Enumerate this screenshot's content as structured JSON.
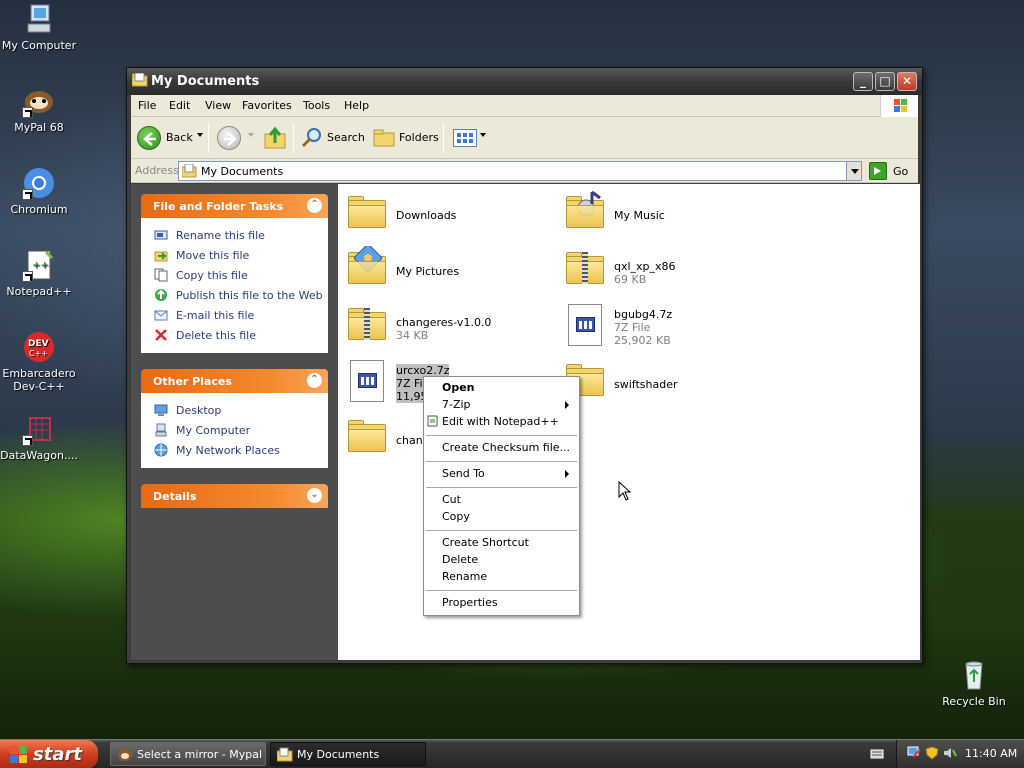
{
  "desktop": {
    "icons": [
      {
        "label": "My Computer",
        "icon": "my-computer-icon"
      },
      {
        "label": "MyPal 68",
        "icon": "mypal-icon"
      },
      {
        "label": "Chromium",
        "icon": "chromium-icon"
      },
      {
        "label": "Notepad++",
        "icon": "notepad-plus-plus-icon"
      },
      {
        "label": "Embarcadero Dev-C++",
        "icon": "dev-cpp-icon",
        "badge": "DEV C++"
      },
      {
        "label": "DataWagon....",
        "icon": "datawagon-icon"
      },
      {
        "label": "Recycle Bin",
        "icon": "recycle-bin-icon"
      }
    ]
  },
  "window": {
    "title": "My Documents",
    "controls": {
      "minimize": "_",
      "maximize": "□",
      "close": "✕"
    },
    "menu": [
      "File",
      "Edit",
      "View",
      "Favorites",
      "Tools",
      "Help"
    ],
    "toolbar": {
      "back": "Back",
      "search": "Search",
      "folders": "Folders"
    },
    "address": {
      "label": "Address",
      "value": "My Documents",
      "go": "Go"
    }
  },
  "taskpane": {
    "file_tasks": {
      "title": "File and Folder Tasks",
      "items": [
        {
          "label": "Rename this file",
          "icon": "rename-icon"
        },
        {
          "label": "Move this file",
          "icon": "move-icon"
        },
        {
          "label": "Copy this file",
          "icon": "copy-icon"
        },
        {
          "label": "Publish this file to the Web",
          "icon": "publish-web-icon"
        },
        {
          "label": "E-mail this file",
          "icon": "email-icon"
        },
        {
          "label": "Delete this file",
          "icon": "delete-icon"
        }
      ]
    },
    "other_places": {
      "title": "Other Places",
      "items": [
        {
          "label": "Desktop",
          "icon": "desktop-icon"
        },
        {
          "label": "My Computer",
          "icon": "my-computer-icon"
        },
        {
          "label": "My Network Places",
          "icon": "network-places-icon"
        }
      ]
    },
    "details": {
      "title": "Details"
    },
    "chevron_up": "⌃",
    "chevron_down": "⌄"
  },
  "files": [
    {
      "name": "Downloads",
      "type": "folder",
      "icon": "folder-icon"
    },
    {
      "name": "My Music",
      "type": "folder",
      "icon": "music-folder-icon"
    },
    {
      "name": "My Pictures",
      "type": "folder",
      "icon": "pictures-folder-icon"
    },
    {
      "name": "qxl_xp_x86",
      "sub1": "69 KB",
      "type": "zip",
      "icon": "zip-folder-icon"
    },
    {
      "name": "changeres-v1.0.0",
      "sub1": "34 KB",
      "type": "zip",
      "icon": "zip-folder-icon"
    },
    {
      "name": "bgubg4.7z",
      "sub1": "7Z File",
      "sub2": "25,902 KB",
      "type": "7z",
      "icon": "7z-file-icon"
    },
    {
      "name": "urcxo2.7z",
      "sub1": "7Z File",
      "sub2": "11,95",
      "type": "7z",
      "icon": "7z-file-icon",
      "selected": true
    },
    {
      "name": "swiftshader",
      "type": "folder",
      "icon": "folder-icon"
    },
    {
      "name": "chang",
      "type": "folder",
      "icon": "folder-icon"
    }
  ],
  "context_menu": {
    "items": [
      {
        "label": "Open",
        "bold": true
      },
      {
        "label": "7-Zip",
        "submenu": true
      },
      {
        "label": "Edit with Notepad++",
        "icon": "notepad-plus-plus-icon"
      },
      {
        "label": "Create Checksum file..."
      },
      {
        "label": "Send To",
        "submenu": true
      },
      {
        "label": "Cut"
      },
      {
        "label": "Copy"
      },
      {
        "label": "Create Shortcut"
      },
      {
        "label": "Delete"
      },
      {
        "label": "Rename"
      },
      {
        "label": "Properties"
      }
    ]
  },
  "taskbar": {
    "start": "start",
    "tasks": [
      {
        "label": "Select a mirror - Mypal",
        "active": false,
        "icon": "mypal-icon"
      },
      {
        "label": "My Documents",
        "active": true,
        "icon": "folder-icon"
      }
    ],
    "clock": "11:40 AM"
  },
  "colors": {
    "panel_header": "#e86a13",
    "link_text": "#2a3d77",
    "selection": "#c0c0c0"
  }
}
